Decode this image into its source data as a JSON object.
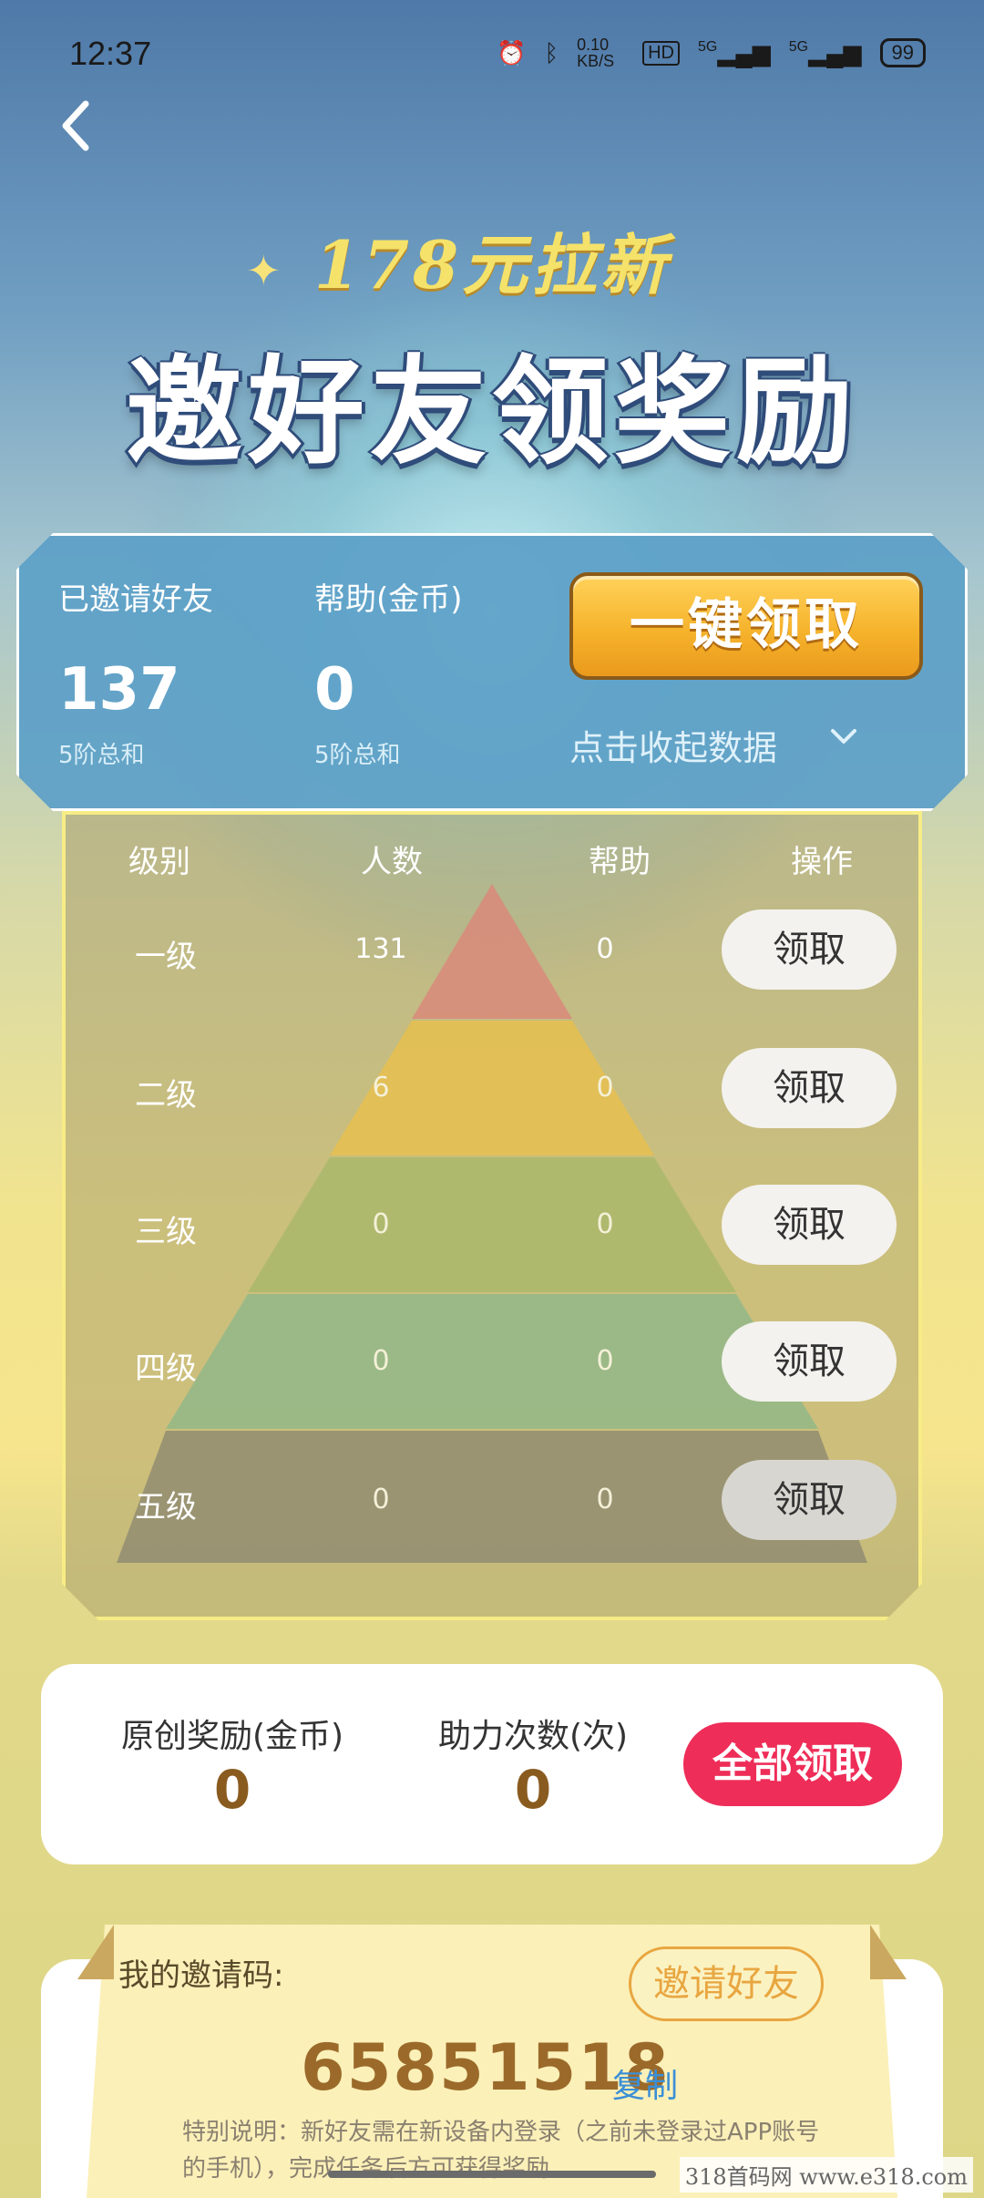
{
  "status_bar": {
    "time": "12:37",
    "net_speed": "0.10 KB/S",
    "hd": "HD",
    "signal1": "5G",
    "signal2": "5G",
    "battery": "99"
  },
  "hero": {
    "subtitle": "178元拉新",
    "title": "邀好友领奖励"
  },
  "stats": {
    "invited_label": "已邀请好友",
    "invited_value": "137",
    "invited_sub": "5阶总和",
    "help_label": "帮助(金币)",
    "help_value": "0",
    "help_sub": "5阶总和",
    "claim_all_label": "一键领取",
    "collapse_label": "点击收起数据"
  },
  "levels": {
    "headers": [
      "级别",
      "人数",
      "帮助",
      "操作"
    ],
    "rows": [
      {
        "level": "一级",
        "count": "131",
        "help": "0",
        "action": "领取"
      },
      {
        "level": "二级",
        "count": "6",
        "help": "0",
        "action": "领取"
      },
      {
        "level": "三级",
        "count": "0",
        "help": "0",
        "action": "领取"
      },
      {
        "level": "四级",
        "count": "0",
        "help": "0",
        "action": "领取"
      },
      {
        "level": "五级",
        "count": "0",
        "help": "0",
        "action": "领取"
      }
    ]
  },
  "rewards": {
    "original_label": "原创奖励(金币)",
    "original_value": "0",
    "assist_label": "助力次数(次)",
    "assist_value": "0",
    "claim_all_label": "全部领取"
  },
  "invite": {
    "label": "我的邀请码:",
    "invite_button": "邀请好友",
    "code": "65851518",
    "copy_label": "复制",
    "note": "特别说明：新好友需在新设备内登录（之前未登录过APP账号的手机），完成任务后方可获得奖励"
  },
  "watermark": "318首码网 www.e318.com",
  "colors": {
    "accent_red": "#ee2d58",
    "gold": "#f6b32c",
    "panel_blue": "#5ca0c8",
    "code_brown": "#9b6a2a",
    "link_blue": "#3b8fd6"
  }
}
